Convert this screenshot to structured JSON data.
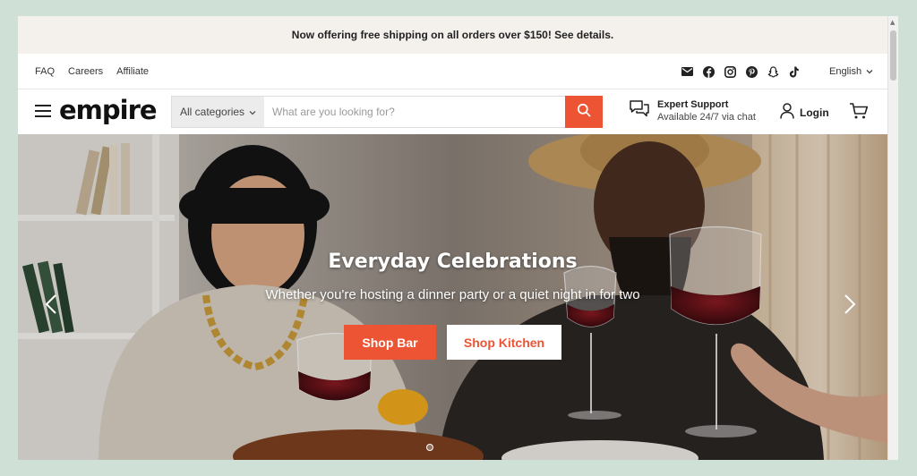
{
  "announcement": "Now offering free shipping on all orders over $150! See details.",
  "utility_links": [
    "FAQ",
    "Careers",
    "Affiliate"
  ],
  "social_icons": [
    "mail-icon",
    "facebook-icon",
    "instagram-icon",
    "pinterest-icon",
    "snapchat-icon",
    "tiktok-icon"
  ],
  "language": "English",
  "logo": "empire",
  "search": {
    "category": "All categories",
    "placeholder": "What are you looking for?"
  },
  "support": {
    "title": "Expert Support",
    "subtitle": "Available 24/7 via chat"
  },
  "login_label": "Login",
  "hero": {
    "title": "Everyday Celebrations",
    "subtitle": "Whether you're hosting a dinner party or a quiet night in for two",
    "primary_button": "Shop Bar",
    "secondary_button": "Shop Kitchen"
  },
  "colors": {
    "accent": "#ec5434",
    "announcement_bg": "#f4f1ec",
    "page_bg": "#cfe0d6"
  }
}
